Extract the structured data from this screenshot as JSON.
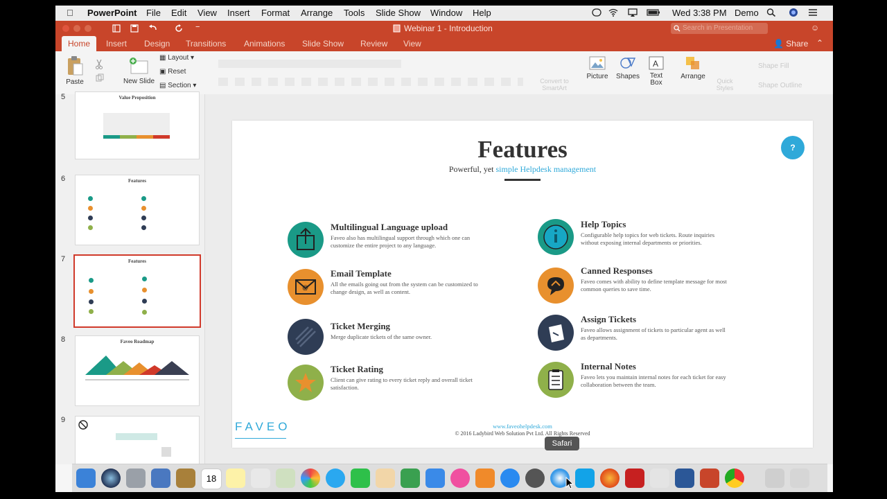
{
  "menubar": {
    "apple": "",
    "app": "PowerPoint",
    "items": [
      "File",
      "Edit",
      "View",
      "Insert",
      "Format",
      "Arrange",
      "Tools",
      "Slide Show",
      "Window",
      "Help"
    ],
    "clock": "Wed 3:38 PM",
    "user": "Demo"
  },
  "titlebar": {
    "doc_title": "Webinar 1 - Introduction",
    "search_placeholder": "Search in Presentation"
  },
  "ribbon_tabs": [
    "Home",
    "Insert",
    "Design",
    "Transitions",
    "Animations",
    "Slide Show",
    "Review",
    "View"
  ],
  "share_label": "Share",
  "ribbon": {
    "paste": "Paste",
    "new_slide": "New Slide",
    "layout": "Layout",
    "reset": "Reset",
    "section": "Section",
    "convert_smartart": "Convert to SmartArt",
    "picture": "Picture",
    "shapes": "Shapes",
    "text_box": "Text Box",
    "arrange": "Arrange",
    "quick_styles": "Quick Styles",
    "shape_fill": "Shape Fill",
    "shape_outline": "Shape Outline"
  },
  "thumbnails": [
    {
      "num": "5",
      "title": "Value Proposition"
    },
    {
      "num": "6",
      "title": "Features"
    },
    {
      "num": "7",
      "title": "Features",
      "selected": true
    },
    {
      "num": "8",
      "title": "Faveo Roadmap"
    },
    {
      "num": "9",
      "title": ""
    }
  ],
  "slide": {
    "title": "Features",
    "subtitle_plain": "Powerful, yet ",
    "subtitle_accent": "simple Helpdesk management",
    "help_badge": "?",
    "features_left": [
      {
        "title": "Multilingual Language upload",
        "desc": "Faveo also has multilingual support through which one can customize the entire project to any language.",
        "color": "#1a9a87",
        "icon": "upload-icon"
      },
      {
        "title": "Email Template",
        "desc": "All the emails going out from the system can be customized to change design, as well as content.",
        "color": "#e8902e",
        "icon": "email-icon"
      },
      {
        "title": "Ticket Merging",
        "desc": "Merge duplicate tickets of the same owner.",
        "color": "#2f3d55",
        "icon": "merge-icon"
      },
      {
        "title": "Ticket Rating",
        "desc": "Client can give rating to every ticket reply and overall ticket satisfaction.",
        "color": "#8fb04a",
        "icon": "star-icon"
      }
    ],
    "features_right": [
      {
        "title": "Help Topics",
        "desc": "Configurable help topics for web tickets. Route inquiries without exposing internal departments or priorities.",
        "color": "#1a9a87",
        "icon": "info-icon"
      },
      {
        "title": "Canned Responses",
        "desc": "Faveo comes with ability to define template message for most common queries to save time.",
        "color": "#e8902e",
        "icon": "chat-icon"
      },
      {
        "title": "Assign Tickets",
        "desc": "Faveo allows assignment of tickets to particular agent as well as departments.",
        "color": "#2f3d55",
        "icon": "assign-icon"
      },
      {
        "title": "Internal Notes",
        "desc": "Faveo lets you maintain internal notes for each ticket for easy collaboration between the team.",
        "color": "#8fb04a",
        "icon": "clipboard-icon"
      }
    ],
    "logo": "FAVEO",
    "footer_url": "www.faveohelpdesk.com",
    "footer_copy": "© 2016 Ladybird Web Solution Pvt Ltd. All Rights Reserved"
  },
  "tooltip": "Safari"
}
